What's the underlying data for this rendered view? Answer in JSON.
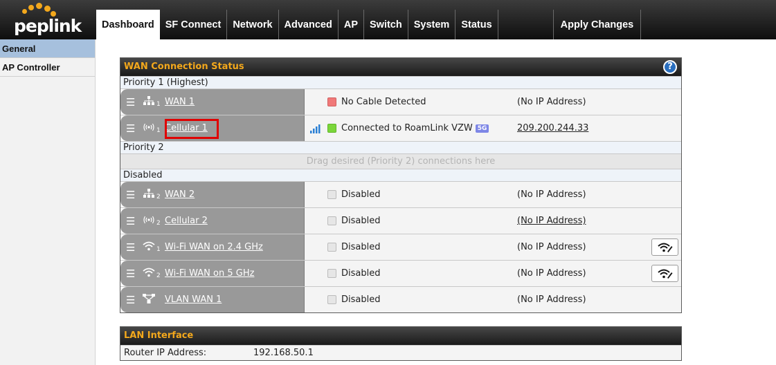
{
  "brand": {
    "name": "peplink",
    "accent": "#f3a81c"
  },
  "nav": {
    "tabs": [
      {
        "label": "Dashboard",
        "active": true
      },
      {
        "label": "SF Connect"
      },
      {
        "label": "Network"
      },
      {
        "label": "Advanced"
      },
      {
        "label": "AP"
      },
      {
        "label": "Switch"
      },
      {
        "label": "System"
      },
      {
        "label": "Status"
      }
    ],
    "apply": "Apply Changes"
  },
  "sidebar": {
    "items": [
      {
        "label": "General",
        "active": true
      },
      {
        "label": "AP Controller"
      }
    ]
  },
  "wan_panel": {
    "title": "WAN Connection Status",
    "help_icon": "help-icon",
    "groups": {
      "priority1": "Priority 1 (Highest)",
      "priority2": "Priority 2",
      "disabled": "Disabled"
    },
    "drop_hint": "Drag desired (Priority 2) connections here",
    "rows": [
      {
        "name": "WAN 1",
        "icon": "ethernet-icon",
        "prio": "1",
        "status": "No Cable Detected",
        "status_color": "#f07878",
        "ip": "(No IP Address)"
      },
      {
        "name": "Cellular 1",
        "icon": "cellular-icon",
        "prio": "1",
        "status": "Connected to RoamLink VZW",
        "badge": "5G",
        "status_color": "#7bd63a",
        "ip": "209.200.244.33"
      },
      {
        "name": "WAN 2",
        "icon": "ethernet-icon",
        "prio": "2",
        "status": "Disabled",
        "ip": "(No IP Address)"
      },
      {
        "name": "Cellular 2",
        "icon": "cellular-icon",
        "prio": "2",
        "status": "Disabled",
        "ip": "(No IP Address)"
      },
      {
        "name": "Wi-Fi WAN on 2.4 GHz",
        "icon": "wifi-icon",
        "prio": "1",
        "status": "Disabled",
        "ip": "(No IP Address)"
      },
      {
        "name": "Wi-Fi WAN on 5 GHz",
        "icon": "wifi-icon",
        "prio": "2",
        "status": "Disabled",
        "ip": "(No IP Address)"
      },
      {
        "name": "VLAN WAN 1",
        "icon": "vlan-icon",
        "prio": "",
        "status": "Disabled",
        "ip": "(No IP Address)"
      }
    ]
  },
  "lan_panel": {
    "title": "LAN Interface",
    "router_ip_label": "Router IP Address:",
    "router_ip": "192.168.50.1"
  }
}
